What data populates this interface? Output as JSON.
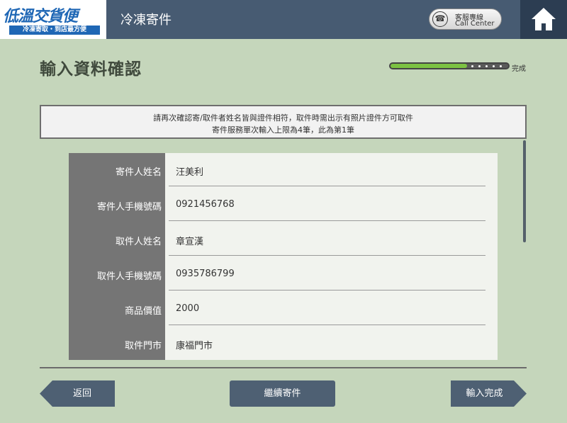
{
  "header": {
    "logo_main": "低溫交貨便",
    "logo_sub": "冷凍寄取・到店最方便",
    "title": "冷凍寄件",
    "call_center_line1": "客服專線",
    "call_center_line2": "Call Center"
  },
  "page": {
    "title": "輸入資料確認",
    "progress_label": "完成",
    "progress_fraction": 0.65
  },
  "notice": {
    "line1": "請再次確認寄/取件者姓名皆與證件相符，取件時需出示有照片證件方可取件",
    "line2": "寄件服務單次輸入上限為4筆，此為第1筆"
  },
  "form": {
    "rows": [
      {
        "label": "寄件人姓名",
        "value": "汪美利"
      },
      {
        "label": "寄件人手機號碼",
        "value": "0921456768"
      },
      {
        "label": "取件人姓名",
        "value": "章宣漢"
      },
      {
        "label": "取件人手機號碼",
        "value": "0935786799"
      },
      {
        "label": "商品價值",
        "value": "2000"
      },
      {
        "label": "取件門市",
        "value": "康福門市"
      }
    ]
  },
  "buttons": {
    "back": "返回",
    "continue": "繼續寄件",
    "finish": "輸入完成"
  },
  "colors": {
    "background": "#c5d6bb",
    "header": "#475b72",
    "button": "#4e6073",
    "progress": "#7cc242",
    "label_column": "#757575"
  },
  "icons": {
    "home": "home-icon",
    "phone": "phone-icon"
  }
}
